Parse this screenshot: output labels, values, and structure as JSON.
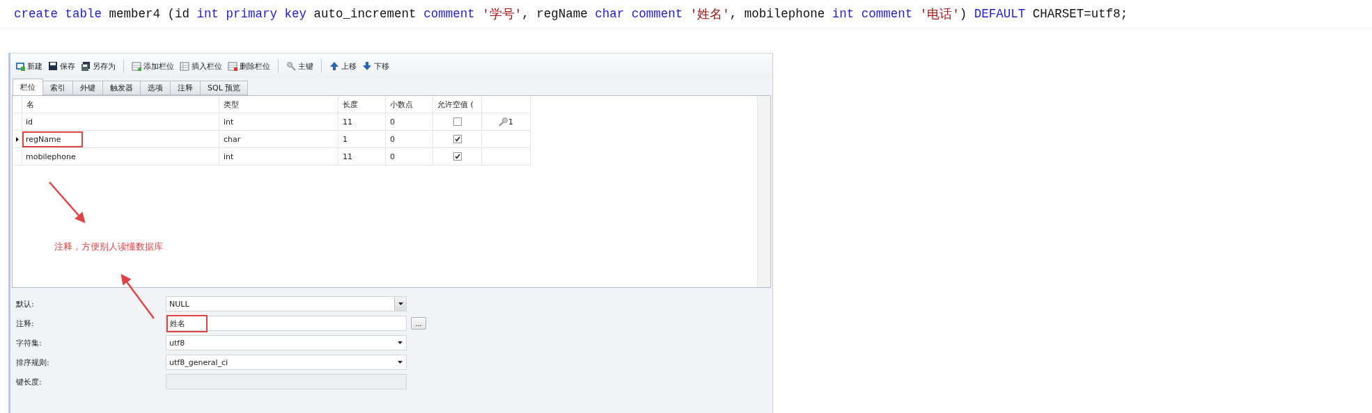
{
  "sql": [
    {
      "kind": "keyword",
      "text": "create table"
    },
    {
      "kind": "plain",
      "text": " member4 (id "
    },
    {
      "kind": "keyword",
      "text": "int primary key"
    },
    {
      "kind": "plain",
      "text": " auto_increment "
    },
    {
      "kind": "keyword",
      "text": "comment"
    },
    {
      "kind": "string",
      "text": " '学号'"
    },
    {
      "kind": "plain",
      "text": ", regName "
    },
    {
      "kind": "keyword",
      "text": "char comment"
    },
    {
      "kind": "string",
      "text": " '姓名'"
    },
    {
      "kind": "plain",
      "text": ", mobilephone "
    },
    {
      "kind": "keyword",
      "text": "int comment"
    },
    {
      "kind": "string",
      "text": " '电话'"
    },
    {
      "kind": "plain",
      "text": ") "
    },
    {
      "kind": "keyword",
      "text": "DEFAULT"
    },
    {
      "kind": "plain",
      "text": " CHARSET=utf8;"
    }
  ],
  "toolbar": [
    [
      "新建",
      "保存",
      "另存为"
    ],
    [
      "添加栏位",
      "插入栏位",
      "删除栏位"
    ],
    [
      "主键"
    ],
    [
      "上移",
      "下移"
    ]
  ],
  "tabs": [
    {
      "label": "栏位",
      "selected": true
    },
    {
      "label": "索引",
      "selected": false
    },
    {
      "label": "外键",
      "selected": false
    },
    {
      "label": "触发器",
      "selected": false
    },
    {
      "label": "选项",
      "selected": false
    },
    {
      "label": "注释",
      "selected": false
    },
    {
      "label": "SQL 预览",
      "selected": false
    }
  ],
  "table": {
    "columns": [
      "名",
      "类型",
      "长度",
      "小数点",
      "允许空值 (",
      ""
    ],
    "rows": [
      {
        "name": "id",
        "type": "int",
        "length": "11",
        "decimal": "0",
        "allow_null": false,
        "key": "1",
        "current": false,
        "highlighted": false
      },
      {
        "name": "regName",
        "type": "char",
        "length": "1",
        "decimal": "0",
        "allow_null": true,
        "current": true,
        "highlighted": true
      },
      {
        "name": "mobilephone",
        "type": "int",
        "length": "11",
        "decimal": "0",
        "allow_null": true,
        "current": false,
        "highlighted": false
      }
    ]
  },
  "properties": [
    {
      "label": "默认:",
      "kind": "combo",
      "value": "NULL"
    },
    {
      "label": "注释:",
      "kind": "text_button",
      "value": "姓名",
      "button": "...",
      "highlighted": true
    },
    {
      "label": "字符集:",
      "kind": "select",
      "value": "utf8"
    },
    {
      "label": "排序规则:",
      "kind": "select",
      "value": "utf8_general_ci"
    },
    {
      "label": "键长度:",
      "kind": "disabled"
    }
  ],
  "annotation": {
    "text": "注释，方便别人读懂数据库"
  }
}
